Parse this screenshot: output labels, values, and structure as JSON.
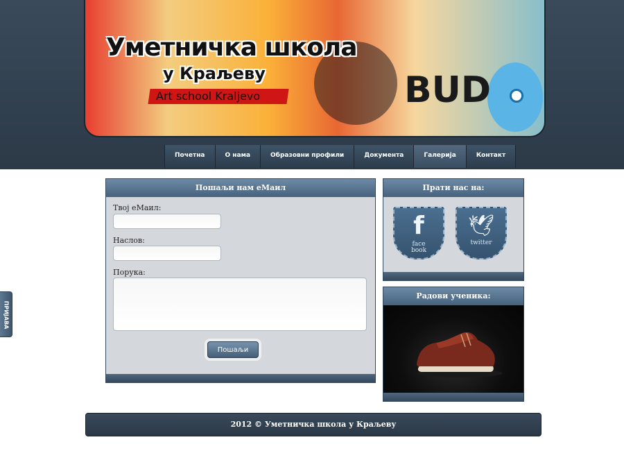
{
  "banner": {
    "title": "Уметничка школа",
    "subtitle": "у Краљеву",
    "english": "Art school Kraljevo",
    "graffiti": "BUD"
  },
  "nav": {
    "items": [
      {
        "label": "Почетна",
        "active": false
      },
      {
        "label": "О нама",
        "active": false
      },
      {
        "label": "Образовни профили",
        "active": false
      },
      {
        "label": "Документа",
        "active": false
      },
      {
        "label": "Галерија",
        "active": true
      },
      {
        "label": "Контакт",
        "active": false
      }
    ]
  },
  "contact_form": {
    "heading": "Пошаљи нам еМаил",
    "email_label": "Твој еМаил:",
    "email_value": "",
    "subject_label": "Наслов:",
    "subject_value": "",
    "message_label": "Порука:",
    "message_value": "",
    "send_label": "Пошаљи"
  },
  "follow": {
    "heading": "Прати нас на:",
    "facebook_icon": "facebook-icon",
    "facebook_letter": "f",
    "facebook_label_line1": "face",
    "facebook_label_line2": "book",
    "twitter_icon": "twitter-bird-icon",
    "twitter_label": "twitter"
  },
  "works": {
    "heading": "Радови ученика:",
    "image": "red-leather-sneaker"
  },
  "footer": {
    "text": "2012 © Уметничка школа у Краљеву"
  },
  "login_tab": {
    "label": "ПРИЈАВА"
  },
  "colors": {
    "header_dark": "#2c3a48",
    "panel_blue": "#46627d",
    "panel_body": "#d4d8dc",
    "banner_red": "#d01515"
  }
}
